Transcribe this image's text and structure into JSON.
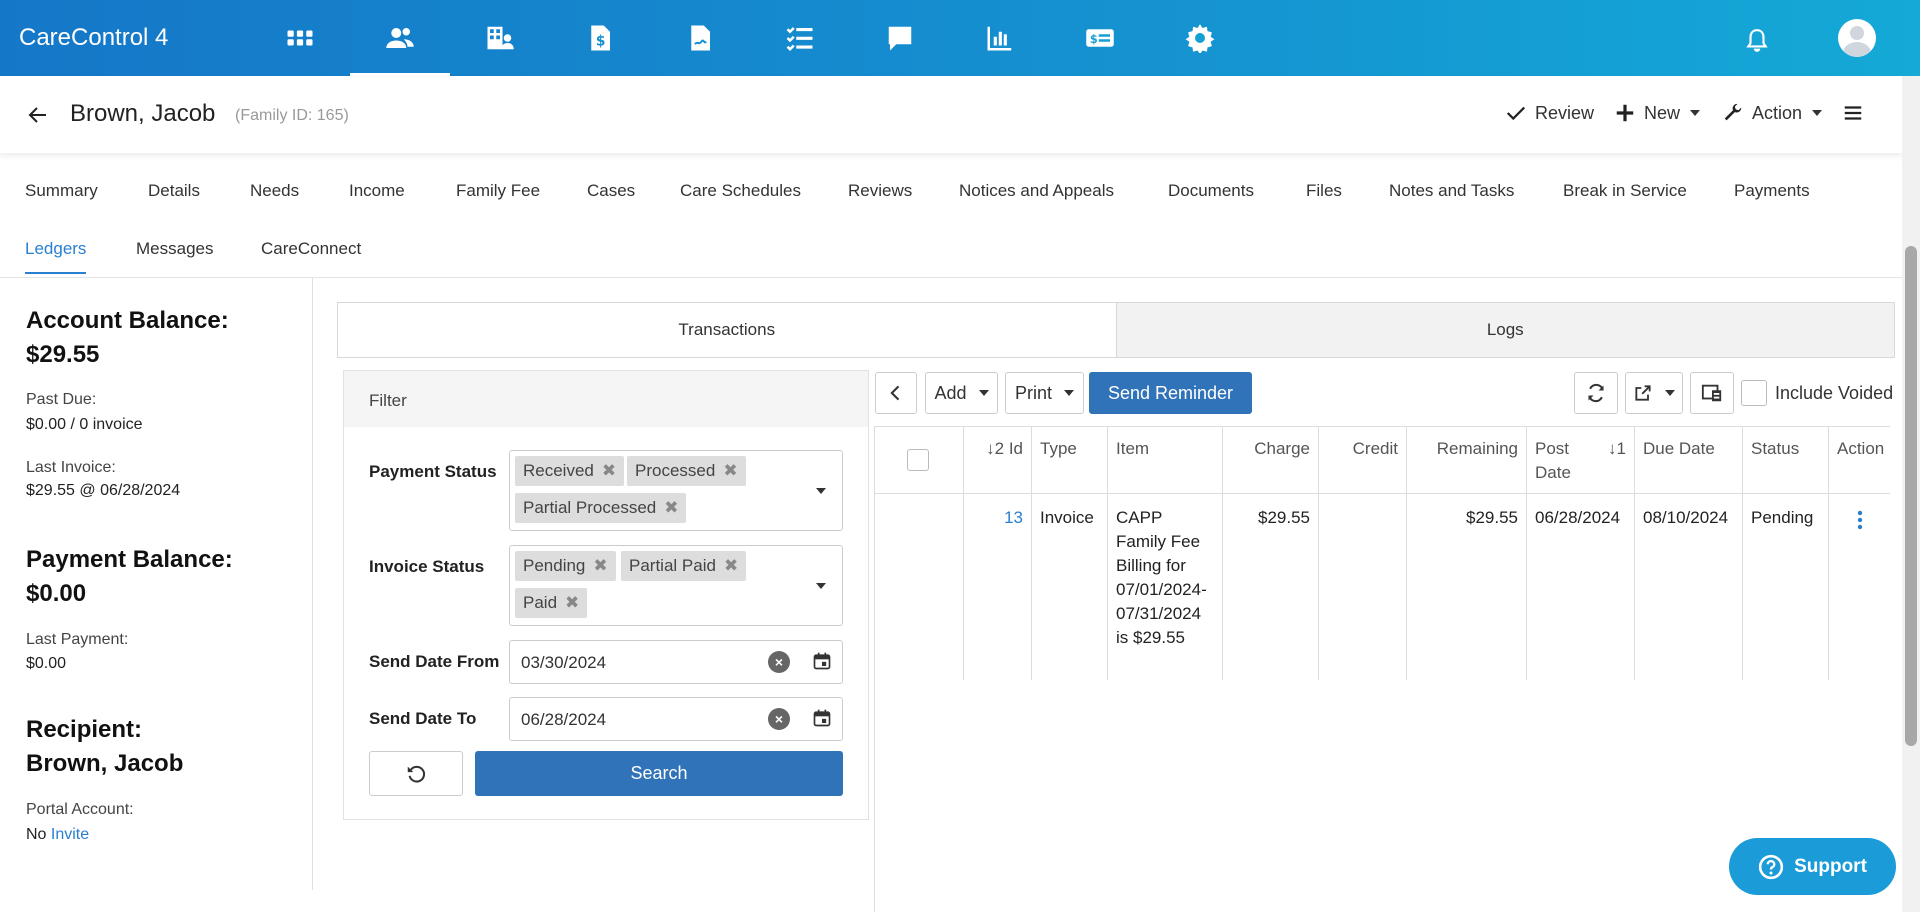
{
  "app": {
    "title": "CareControl 4"
  },
  "nav_icons": [
    "apps-grid-icon",
    "people-icon",
    "providers-icon",
    "invoice-icon",
    "contract-icon",
    "tasks-icon",
    "messages-icon",
    "reports-icon",
    "payments-icon",
    "settings-icon"
  ],
  "header": {
    "name": "Brown, Jacob",
    "family_id": "(Family ID: 165)",
    "review": "Review",
    "new": "New",
    "action": "Action"
  },
  "tabs": [
    "Summary",
    "Details",
    "Needs",
    "Income",
    "Family Fee",
    "Cases",
    "Care Schedules",
    "Reviews",
    "Notices and Appeals",
    "Documents",
    "Files",
    "Notes and Tasks",
    "Break in Service",
    "Payments",
    "Ledgers",
    "Messages",
    "CareConnect"
  ],
  "left": {
    "account_balance_label": "Account Balance:",
    "account_balance": "$29.55",
    "past_due_label": "Past Due:",
    "past_due": "$0.00 / 0 invoice",
    "last_invoice_label": "Last Invoice:",
    "last_invoice": "$29.55 @ 06/28/2024",
    "payment_balance_label": "Payment Balance:",
    "payment_balance": "$0.00",
    "last_payment_label": "Last Payment:",
    "last_payment": "$0.00",
    "recipient_label": "Recipient:",
    "recipient": "Brown, Jacob",
    "portal_label": "Portal Account:",
    "portal_value": "No",
    "invite": "Invite"
  },
  "main_tabs": [
    "Transactions",
    "Logs"
  ],
  "filter": {
    "title": "Filter",
    "payment_status_label": "Payment Status",
    "payment_status": [
      "Received",
      "Processed",
      "Partial Processed"
    ],
    "invoice_status_label": "Invoice Status",
    "invoice_status": [
      "Pending",
      "Partial Paid",
      "Paid"
    ],
    "send_from_label": "Send Date From",
    "send_from": "03/30/2024",
    "send_to_label": "Send Date To",
    "send_to": "06/28/2024",
    "search": "Search"
  },
  "toolbar": {
    "add": "Add",
    "print": "Print",
    "send_reminder": "Send Reminder",
    "include_voided": "Include Voided"
  },
  "table": {
    "headers": [
      "",
      "↓2 Id",
      "Type",
      "Item",
      "Charge",
      "Credit",
      "Remaining",
      "Post Date",
      "↓1",
      "Due Date",
      "Status",
      "Action"
    ],
    "rows": [
      {
        "id": "13",
        "type": "Invoice",
        "item": "CAPP Family Fee Billing for 07/01/2024-07/31/2024 is $29.55",
        "charge": "$29.55",
        "credit": "",
        "remaining": "$29.55",
        "post_date": "06/28/2024",
        "due_date": "08/10/2024",
        "status": "Pending"
      }
    ]
  },
  "support": "Support",
  "colors": {
    "brand": "#1577c8",
    "accent": "#2a7fd0",
    "primary_button": "#3173b8",
    "support": "#1b9bd8"
  }
}
